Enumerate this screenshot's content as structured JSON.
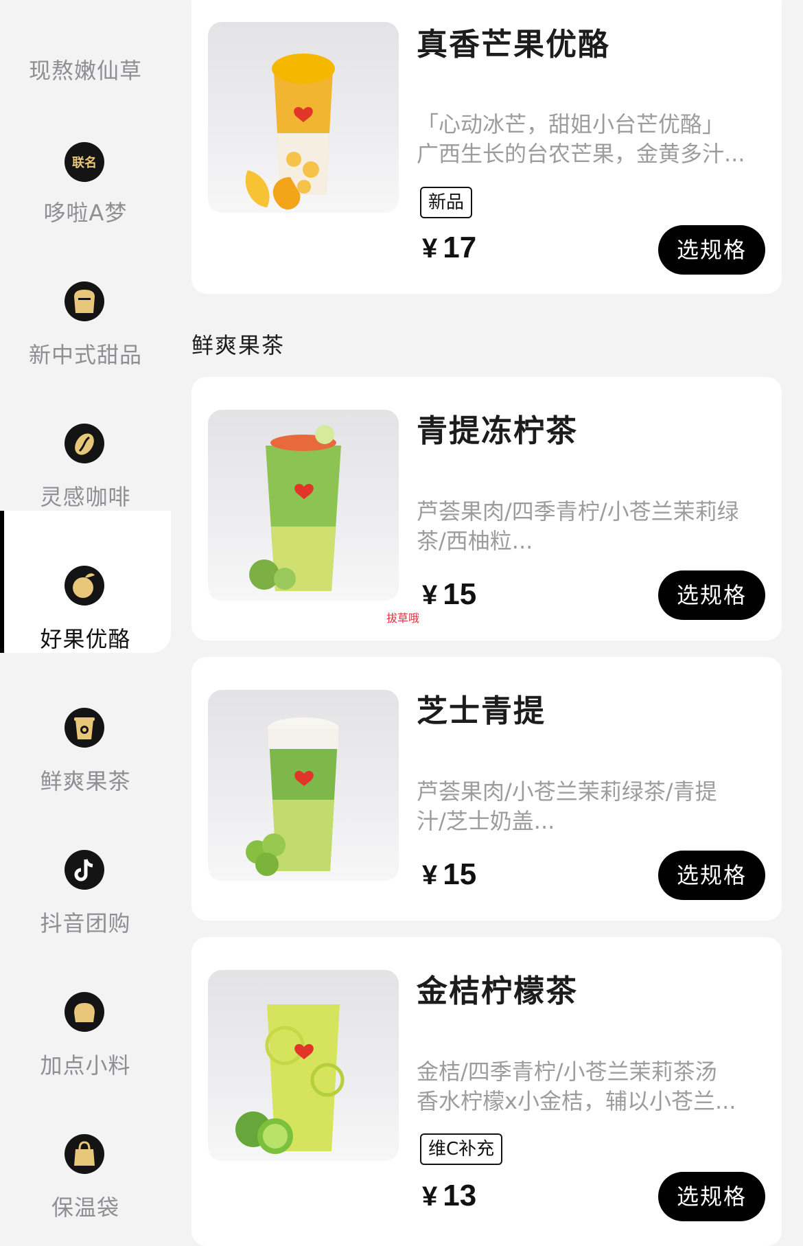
{
  "sidebar": {
    "items": [
      {
        "label": "现熬嫩仙草",
        "icon": "herb-icon"
      },
      {
        "label": "哆啦A梦",
        "icon": "co-brand-badge-icon",
        "badge": "联名"
      },
      {
        "label": "新中式甜品",
        "icon": "dessert-icon"
      },
      {
        "label": "灵感咖啡",
        "icon": "coffee-bean-icon"
      },
      {
        "label": "好果优酪",
        "icon": "fruit-yogurt-icon",
        "active": true
      },
      {
        "label": "鲜爽果茶",
        "icon": "fruit-tea-cup-icon"
      },
      {
        "label": "抖音团购",
        "icon": "douyin-icon"
      },
      {
        "label": "加点小料",
        "icon": "toppings-icon"
      },
      {
        "label": "保温袋",
        "icon": "bag-icon"
      }
    ]
  },
  "section": {
    "title": "鲜爽果茶"
  },
  "products": [
    {
      "name": "真香芒果优酪",
      "desc_line1": "「心动冰芒，甜姐小台芒优酪」",
      "desc_line2": "广西生长的台农芒果，金黄多汁...",
      "tag": "新品",
      "currency": "¥",
      "price": "17",
      "button": "选规格"
    },
    {
      "name": "青提冻柠茶",
      "desc_line1": "芦荟果肉/四季青柠/小苍兰茉莉绿",
      "desc_line2": "茶/西柚粒...",
      "currency": "¥",
      "price": "15",
      "button": "选规格"
    },
    {
      "name": "芝士青提",
      "desc_line1": "芦荟果肉/小苍兰茉莉绿茶/青提",
      "desc_line2": "汁/芝士奶盖...",
      "currency": "¥",
      "price": "15",
      "button": "选规格"
    },
    {
      "name": "金桔柠檬茶",
      "desc_line1": "金桔/四季青柠/小苍兰茉莉茶汤",
      "desc_line2": "香水柠檬x小金桔，辅以小苍兰...",
      "tag": "维C补充",
      "currency": "¥",
      "price": "13",
      "button": "选规格"
    }
  ],
  "watermark": "拔草哦",
  "colors": {
    "accent": "#000000",
    "background": "#f3f3f3",
    "card": "#ffffff",
    "icon_gold": "#e9c77a"
  }
}
